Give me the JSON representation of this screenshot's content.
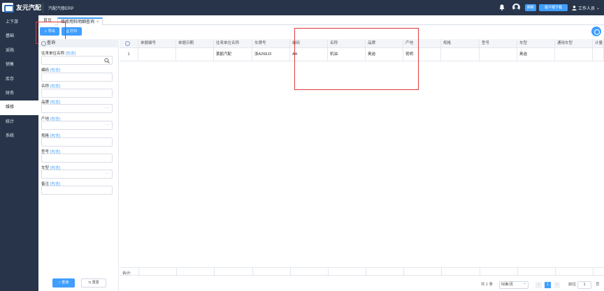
{
  "header": {
    "logo_text": "友元汽配",
    "system_name": "汽配汽修ERP",
    "ticket_label": "刷新",
    "download_label": "客户端下载",
    "user_label": "工作人员"
  },
  "sidebar": {
    "items": [
      {
        "label": "上下游"
      },
      {
        "label": "基础"
      },
      {
        "label": "采购"
      },
      {
        "label": "销售"
      },
      {
        "label": "库存"
      },
      {
        "label": "财务"
      },
      {
        "label": "维修"
      },
      {
        "label": "统计"
      },
      {
        "label": "系统"
      }
    ],
    "active_index": 6
  },
  "tabs": {
    "home": "首页",
    "active": "维修用料明细查询",
    "close_glyph": "×"
  },
  "toolbar": {
    "export_label": "导出",
    "print_label": "打印"
  },
  "query": {
    "title": "查询",
    "include_label": "[包含]",
    "fields": [
      {
        "label": "往来单位名称",
        "type": "search"
      },
      {
        "label": "编码",
        "type": "text"
      },
      {
        "label": "名称",
        "type": "text"
      },
      {
        "label": "品牌",
        "type": "picker"
      },
      {
        "label": "产地",
        "type": "picker"
      },
      {
        "label": "规格",
        "type": "text"
      },
      {
        "label": "型号",
        "type": "text"
      },
      {
        "label": "车型",
        "type": "picker"
      },
      {
        "label": "备注",
        "type": "text"
      }
    ],
    "search_label": "查询",
    "reset_label": "重置"
  },
  "grid": {
    "columns": [
      "",
      "单据编号",
      "单据日期",
      "往来单位名称",
      "车牌号",
      "编码",
      "名称",
      "品牌",
      "产地",
      "规格",
      "型号",
      "车型",
      "通用车型",
      "计量"
    ],
    "rows": [
      [
        "1",
        "",
        "",
        "黄鹤汽配",
        "浙A268J3",
        "AA",
        "机油",
        "奥迪",
        "昆明",
        "",
        "",
        "奥迪",
        "",
        ""
      ]
    ],
    "summary_label": "合计:"
  },
  "pagination": {
    "total_text": "共 1 条",
    "page_size": "50条/页",
    "current_page": "1",
    "goto_label": "前往",
    "goto_value": "1",
    "page_suffix": "页"
  }
}
